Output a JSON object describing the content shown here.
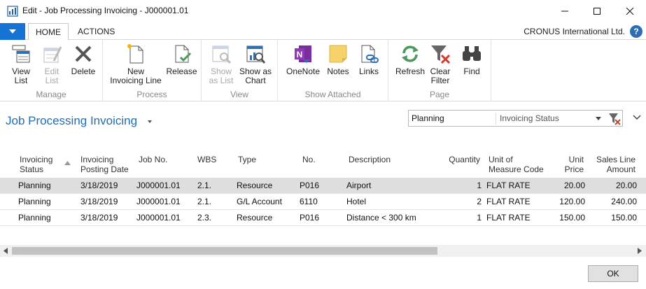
{
  "window": {
    "title": "Edit - Job Processing Invoicing - J000001.01"
  },
  "tabs": [
    {
      "label": "HOME"
    },
    {
      "label": "ACTIONS"
    }
  ],
  "company": "CRONUS International Ltd.",
  "ribbon": {
    "groups": [
      {
        "label": "Manage",
        "buttons": [
          {
            "label1": "View",
            "label2": "List",
            "icon": "view-list-icon",
            "enabled": true
          },
          {
            "label1": "Edit",
            "label2": "List",
            "icon": "edit-list-icon",
            "enabled": false
          },
          {
            "label1": "Delete",
            "label2": "",
            "icon": "delete-icon",
            "enabled": true
          }
        ]
      },
      {
        "label": "Process",
        "buttons": [
          {
            "label1": "New",
            "label2": "Invoicing Line",
            "icon": "new-document-icon",
            "enabled": true
          },
          {
            "label1": "Release",
            "label2": "",
            "icon": "release-icon",
            "enabled": true
          }
        ]
      },
      {
        "label": "View",
        "buttons": [
          {
            "label1": "Show",
            "label2": "as List",
            "icon": "show-list-icon",
            "enabled": false
          },
          {
            "label1": "Show as",
            "label2": "Chart",
            "icon": "show-chart-icon",
            "enabled": true
          }
        ]
      },
      {
        "label": "Show Attached",
        "buttons": [
          {
            "label1": "OneNote",
            "label2": "",
            "icon": "onenote-icon",
            "enabled": true
          },
          {
            "label1": "Notes",
            "label2": "",
            "icon": "notes-icon",
            "enabled": true
          },
          {
            "label1": "Links",
            "label2": "",
            "icon": "links-icon",
            "enabled": true
          }
        ]
      },
      {
        "label": "Page",
        "buttons": [
          {
            "label1": "Refresh",
            "label2": "",
            "icon": "refresh-icon",
            "enabled": true
          },
          {
            "label1": "Clear",
            "label2": "Filter",
            "icon": "clear-filter-icon",
            "enabled": true
          },
          {
            "label1": "Find",
            "label2": "",
            "icon": "binoculars-icon",
            "enabled": true
          }
        ]
      }
    ]
  },
  "page": {
    "title": "Job Processing Invoicing"
  },
  "filter": {
    "value": "Planning",
    "field": "Invoicing Status"
  },
  "columns": [
    {
      "line1": "Invoicing",
      "line2": "Status"
    },
    {
      "line1": "Invoicing",
      "line2": "Posting Date"
    },
    {
      "line1": "Job No.",
      "line2": ""
    },
    {
      "line1": "WBS",
      "line2": ""
    },
    {
      "line1": "Type",
      "line2": ""
    },
    {
      "line1": "No.",
      "line2": ""
    },
    {
      "line1": "Description",
      "line2": ""
    },
    {
      "line1": "Quantity",
      "line2": ""
    },
    {
      "line1": "Unit of",
      "line2": "Measure Code"
    },
    {
      "line1": "Unit",
      "line2": "Price"
    },
    {
      "line1": "Sales Line",
      "line2": "Amount"
    }
  ],
  "rows": [
    {
      "status": "Planning",
      "date": "3/18/2019",
      "job": "J000001.01",
      "wbs": "2.1.",
      "type": "Resource",
      "no": "P016",
      "desc": "Airport",
      "qty": "1",
      "uom": "FLAT RATE",
      "price": "20.00",
      "amount": "20.00"
    },
    {
      "status": "Planning",
      "date": "3/18/2019",
      "job": "J000001.01",
      "wbs": "2.1.",
      "type": "G/L Account",
      "no": "6110",
      "desc": "Hotel",
      "qty": "2",
      "uom": "FLAT RATE",
      "price": "120.00",
      "amount": "240.00"
    },
    {
      "status": "Planning",
      "date": "3/18/2019",
      "job": "J000001.01",
      "wbs": "2.3.",
      "type": "Resource",
      "no": "P016",
      "desc": "Distance < 300 km",
      "qty": "1",
      "uom": "FLAT RATE",
      "price": "150.00",
      "amount": "150.00"
    }
  ],
  "footer": {
    "ok_label": "OK"
  },
  "colors": {
    "accent": "#1672d3",
    "title_blue": "#1f6db5",
    "selected_row": "#dedede"
  }
}
